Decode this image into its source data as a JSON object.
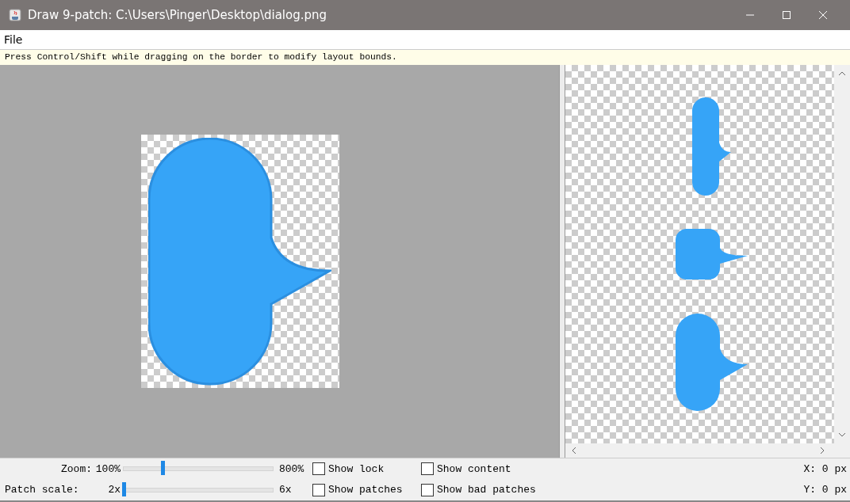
{
  "window": {
    "title": "Draw 9-patch: C:\\Users\\Pinger\\Desktop\\dialog.png"
  },
  "menu": [
    "File"
  ],
  "hint": "Press Control/Shift while dragging on the border to modify layout bounds.",
  "sliders": [
    {
      "label": "Zoom:",
      "min": "100%",
      "max": "800%",
      "level": 0.26
    },
    {
      "label": "Patch scale:",
      "min": "2x",
      "max": "6x",
      "level": 0
    }
  ],
  "checkboxes": [
    {
      "label": "Show lock",
      "checked": false
    },
    {
      "label": "Show content",
      "checked": false
    },
    {
      "label": "Show patches",
      "checked": false
    },
    {
      "label": "Show bad patches",
      "checked": false
    }
  ],
  "coordinates": [
    "X: 0 px",
    "Y: 0 px"
  ]
}
